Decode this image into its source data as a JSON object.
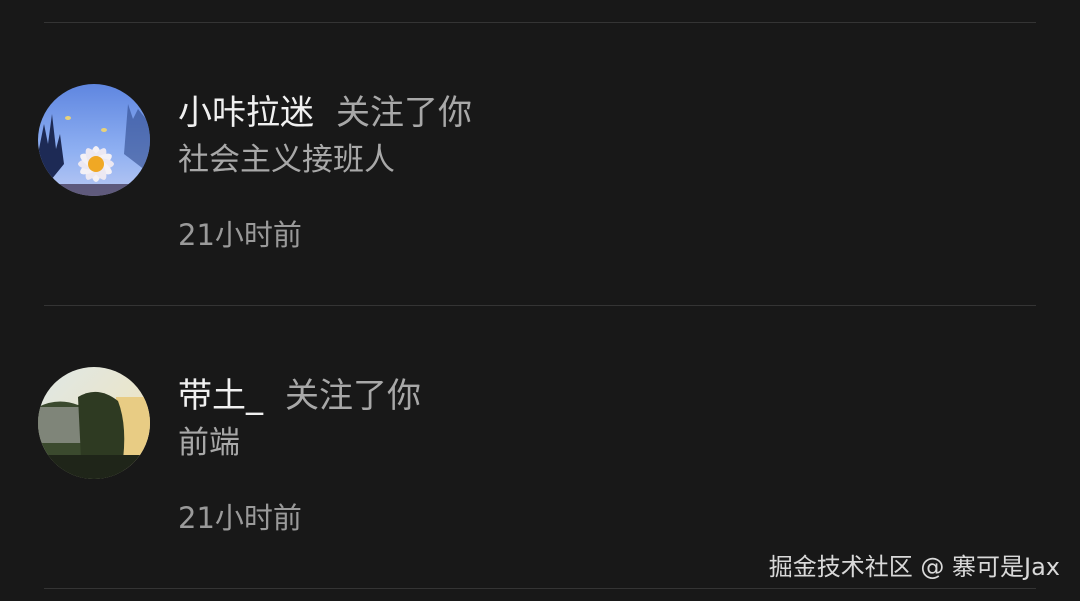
{
  "notifications": [
    {
      "username": "小咔拉迷",
      "action": "关注了你",
      "bio": "社会主义接班人",
      "time": "21小时前",
      "avatar_icon": "daisy-photo"
    },
    {
      "username": "带土_",
      "action": "关注了你",
      "bio": "前端",
      "time": "21小时前",
      "avatar_icon": "landscape-photo"
    }
  ],
  "watermark": "掘金技术社区 @ 寨可是Jax",
  "colors": {
    "background": "#181818",
    "divider": "#343434",
    "primary_text": "#f0f0f0",
    "secondary_text": "#a8a8a8"
  }
}
